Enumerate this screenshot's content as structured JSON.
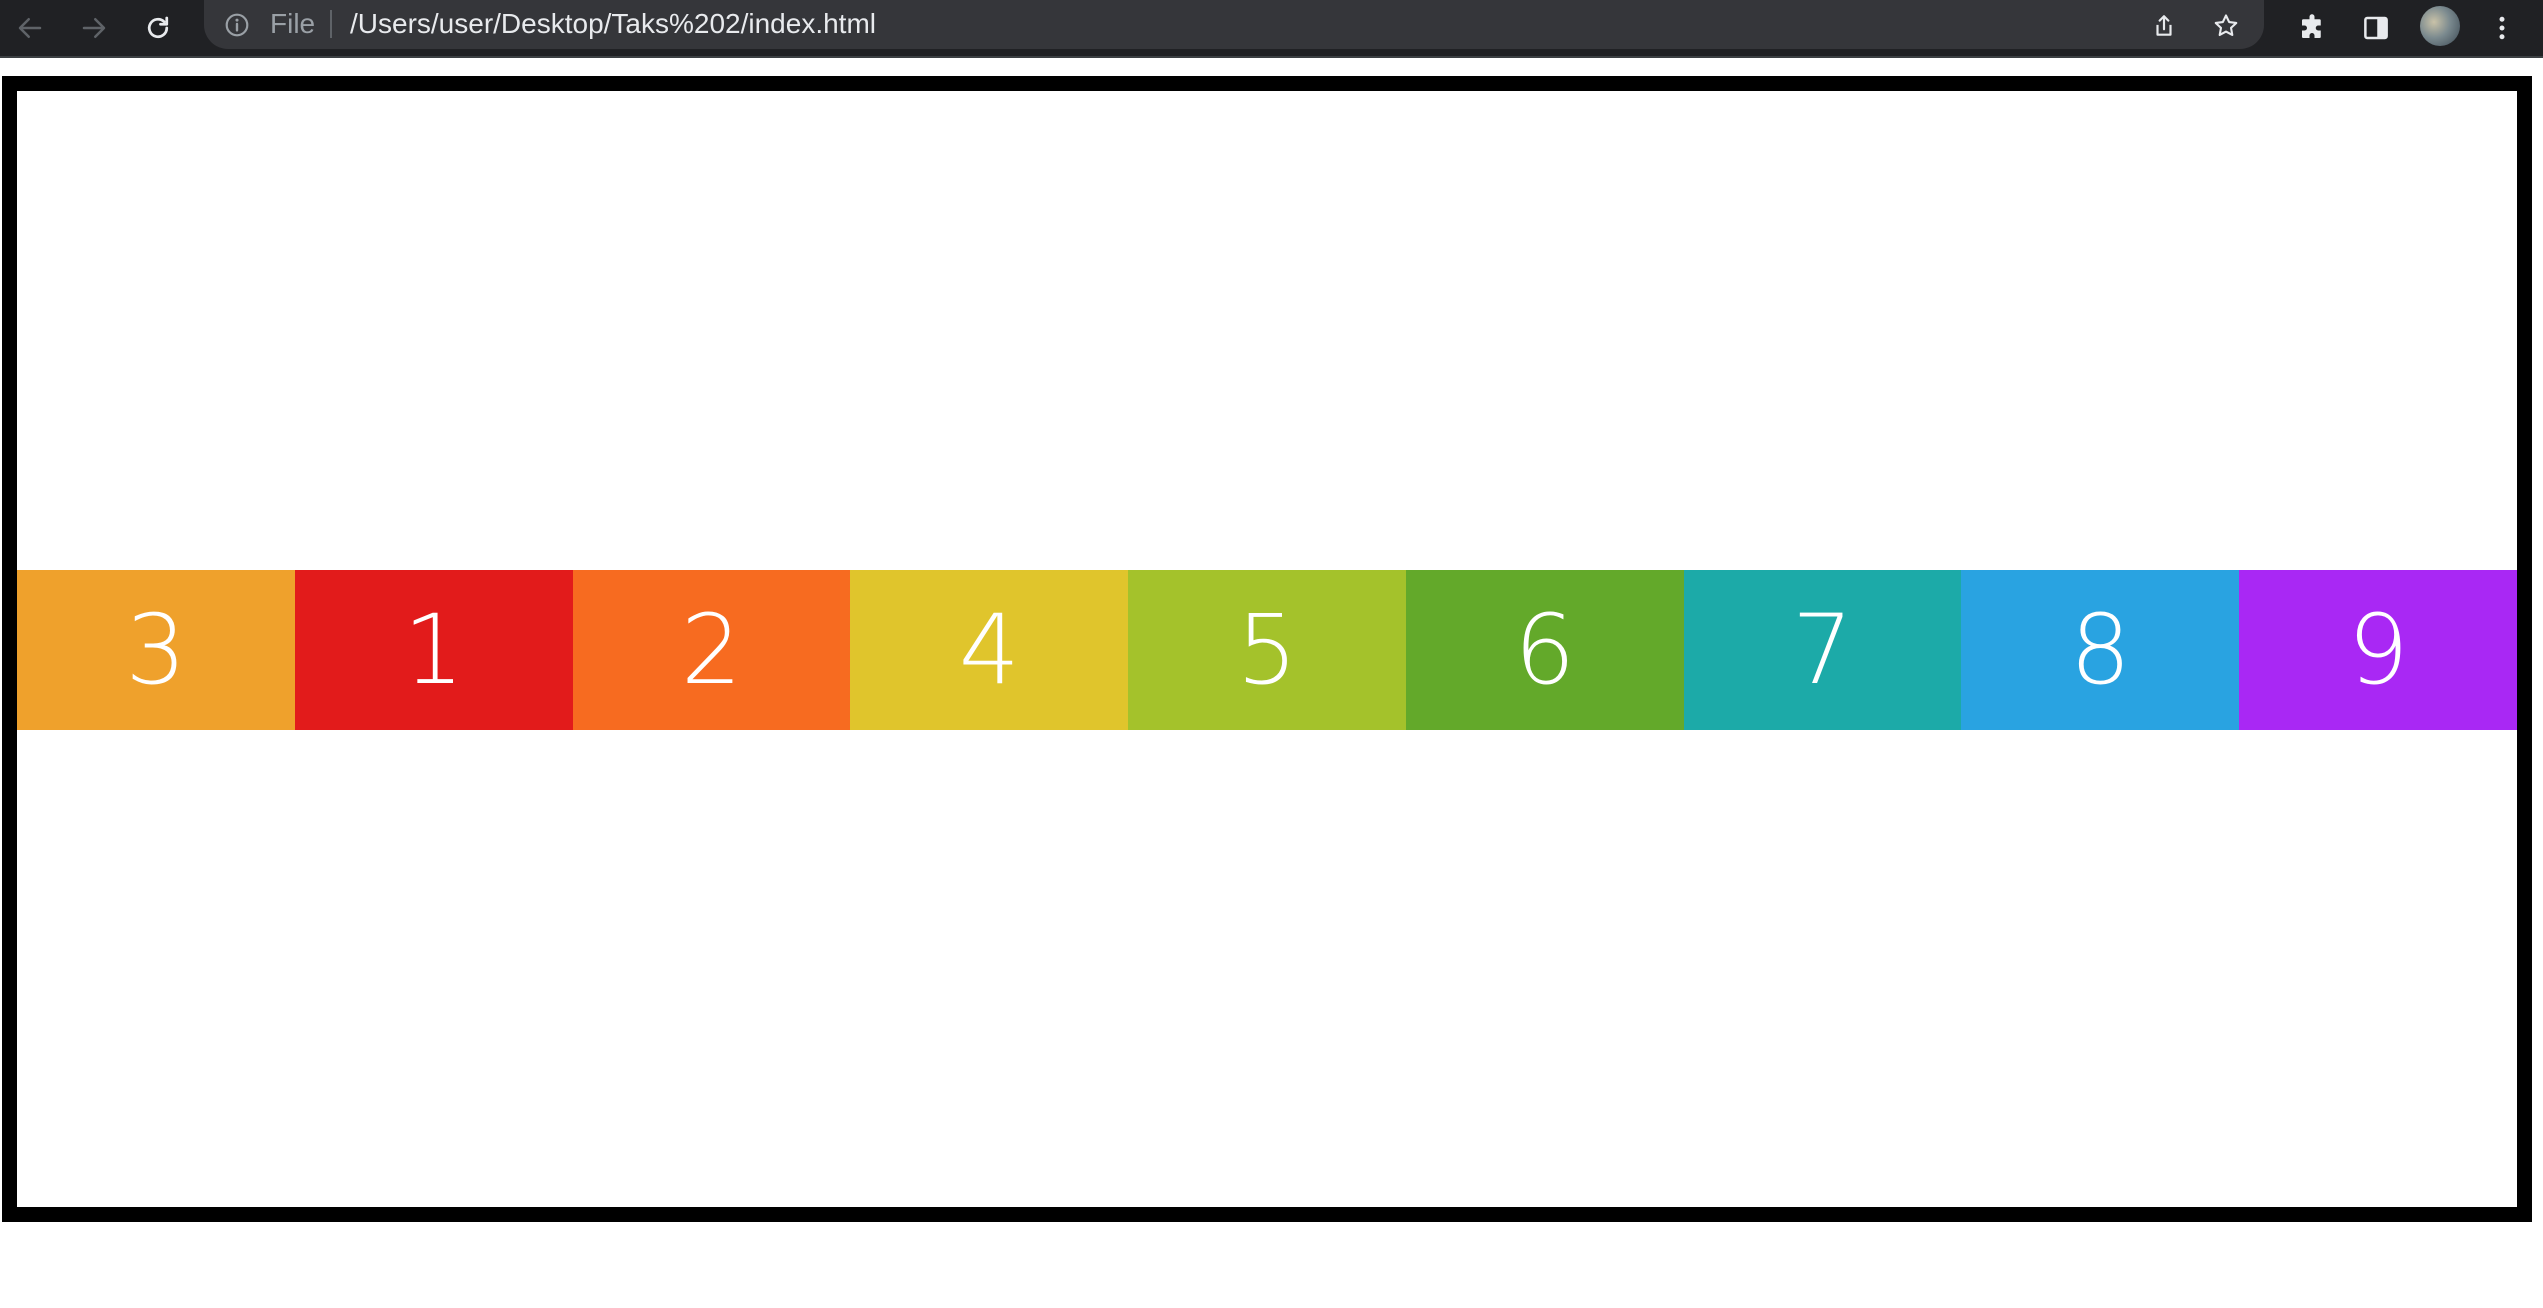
{
  "browser": {
    "scheme_label": "File",
    "url": "/Users/user/Desktop/Taks%202/index.html",
    "icons": {
      "back": "arrow-left-icon",
      "forward": "arrow-right-icon",
      "reload": "reload-icon",
      "info": "info-icon",
      "share": "share-icon",
      "bookmark": "star-icon",
      "extensions": "puzzle-icon",
      "side_panel": "side-panel-icon",
      "profile": "avatar",
      "menu": "kebab-menu-icon"
    },
    "colors": {
      "toolbar_bg": "#202124",
      "omnibox_bg": "#35363a",
      "url_text": "#e8eaed",
      "muted_text": "#9aa0a6"
    }
  },
  "page": {
    "frame_border_color": "#000000",
    "boxes": [
      {
        "label": "3",
        "color": "#EFA12C"
      },
      {
        "label": "1",
        "color": "#E21B1B"
      },
      {
        "label": "2",
        "color": "#F76B20"
      },
      {
        "label": "4",
        "color": "#E0C52C"
      },
      {
        "label": "5",
        "color": "#A4C22B"
      },
      {
        "label": "6",
        "color": "#63A92A"
      },
      {
        "label": "7",
        "color": "#1CAAA8"
      },
      {
        "label": "8",
        "color": "#29A3E1"
      },
      {
        "label": "9",
        "color": "#A928F4"
      }
    ]
  }
}
